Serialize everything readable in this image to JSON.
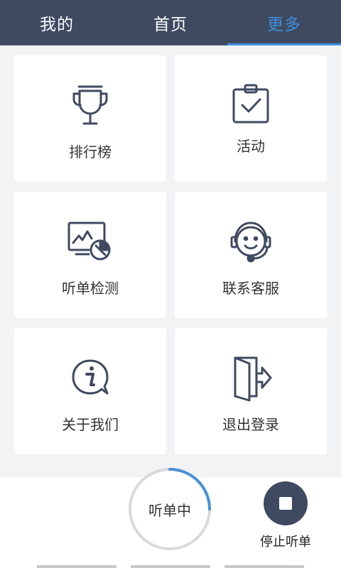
{
  "tabs": [
    {
      "label": "我的",
      "active": false
    },
    {
      "label": "首页",
      "active": false
    },
    {
      "label": "更多",
      "active": true
    }
  ],
  "colors": {
    "header_bg": "#3f4a61",
    "accent": "#3d8ede",
    "icon_stroke": "#3f4a61"
  },
  "menu": [
    {
      "label": "排行榜",
      "icon": "trophy-icon"
    },
    {
      "label": "活动",
      "icon": "clipboard-check-icon"
    },
    {
      "label": "听单检测",
      "icon": "monitor-check-icon"
    },
    {
      "label": "联系客服",
      "icon": "headset-icon"
    },
    {
      "label": "关于我们",
      "icon": "info-bubble-icon"
    },
    {
      "label": "退出登录",
      "icon": "exit-door-icon"
    }
  ],
  "bottom_bar": {
    "status_label": "听单中",
    "status_progress": 0.25,
    "stop_label": "停止听单"
  }
}
